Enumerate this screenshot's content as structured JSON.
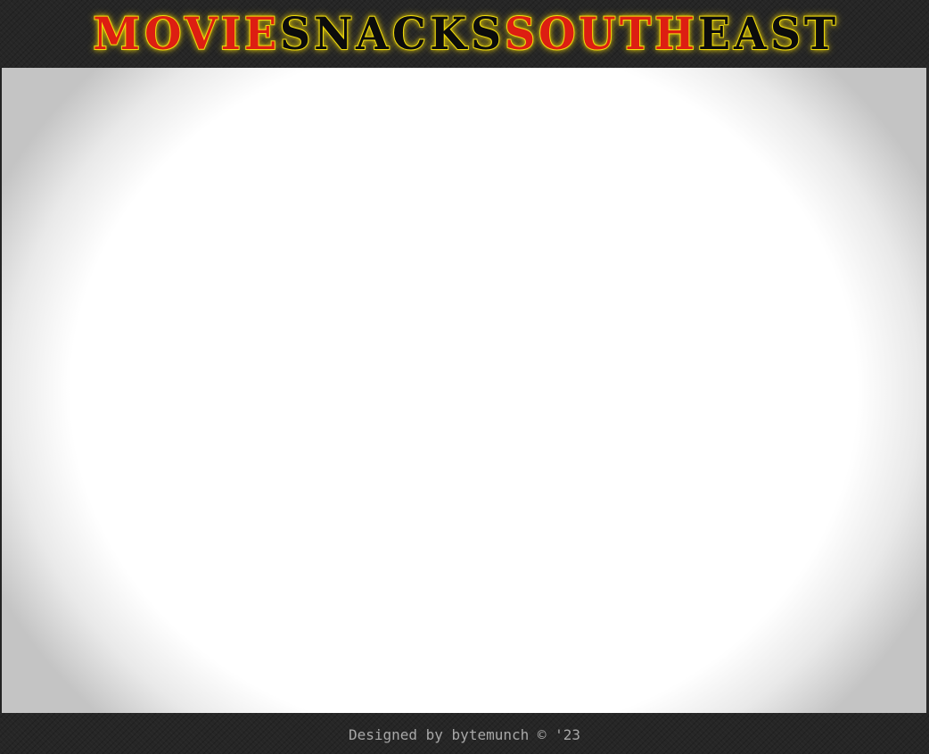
{
  "header": {
    "logo_words": [
      {
        "text": "MOVIE",
        "color": "#dd1e12"
      },
      {
        "text": "SNACKS",
        "color": "#0c0c0c"
      },
      {
        "text": "SOUTH",
        "color": "#dd1e12"
      },
      {
        "text": "EAST",
        "color": "#0c0c0c"
      }
    ],
    "glow_color": "#e6d200"
  },
  "footer": {
    "credit": "Designed by bytemunch © '23"
  }
}
